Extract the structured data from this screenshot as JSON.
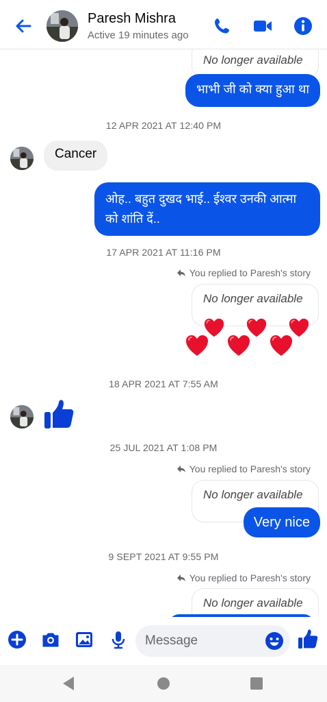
{
  "header": {
    "contact_name": "Paresh Mishra",
    "status": "Active 19 minutes ago",
    "icons": [
      "back-arrow-icon",
      "phone-icon",
      "video-icon",
      "info-icon"
    ],
    "accent_color": "#0a55e8"
  },
  "messages": {
    "story1": "No longer available",
    "out1": "भाभी जी को क्या हुआ था",
    "ts1": "12 APR 2021 AT 12:40 PM",
    "in1": "Cancer",
    "out2_line1": "ओह.. बहुत दुखद भाई.. ईश्वर उनकी आत्मा",
    "out2_line2": "को शांति दें..",
    "ts2": "17 APR 2021 AT 11:16 PM",
    "reply2": "You replied to Paresh's story",
    "story2": "No longer available",
    "ts3": "18 APR 2021 AT 7:55 AM",
    "ts4": "25 JUL 2021 AT 1:08 PM",
    "reply4": "You replied to Paresh's story",
    "story4": "No longer available",
    "out4": "Very nice",
    "ts5": "9 SEPT 2021 AT 9:55 PM",
    "reply5": "You replied to Paresh's story",
    "story5": "No longer available"
  },
  "composer": {
    "placeholder": "Message",
    "icons": [
      "plus-icon",
      "camera-icon",
      "gallery-icon",
      "mic-icon",
      "emoji-icon",
      "like-icon"
    ]
  },
  "navbar": {
    "icons": [
      "nav-back-icon",
      "nav-home-icon",
      "nav-recents-icon"
    ]
  }
}
